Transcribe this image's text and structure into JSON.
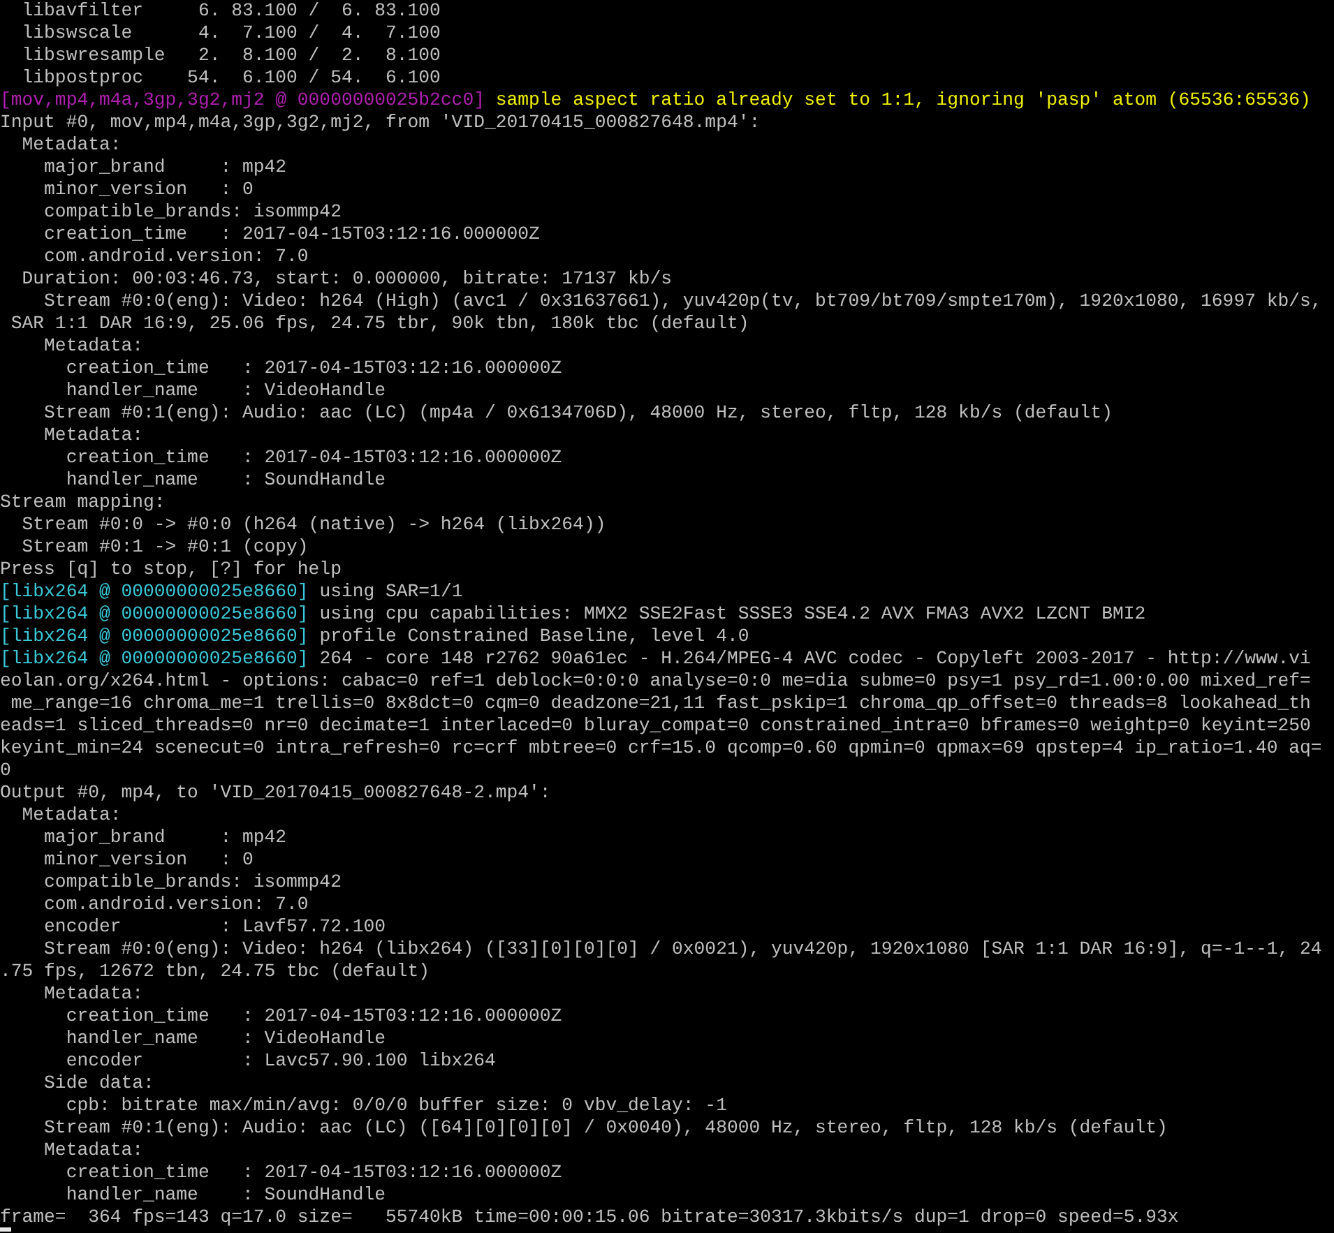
{
  "console": {
    "lines": [
      [
        {
          "kind": "plain",
          "text": "  libavfilter     6. 83.100 /  6. 83.100"
        }
      ],
      [
        {
          "kind": "plain",
          "text": "  libswscale      4.  7.100 /  4.  7.100"
        }
      ],
      [
        {
          "kind": "plain",
          "text": "  libswresample   2.  8.100 /  2.  8.100"
        }
      ],
      [
        {
          "kind": "plain",
          "text": "  libpostproc    54.  6.100 / 54.  6.100"
        }
      ],
      [
        {
          "kind": "demuxer",
          "text": "[mov,mp4,m4a,3gp,3g2,mj2 @ 00000000025b2cc0]"
        },
        {
          "kind": "warning",
          "text": " sample aspect ratio already set to 1:1, ignoring 'pasp' atom (65536:65536)"
        }
      ],
      [
        {
          "kind": "plain",
          "text": "Input #0, mov,mp4,m4a,3gp,3g2,mj2, from 'VID_20170415_000827648.mp4':"
        }
      ],
      [
        {
          "kind": "plain",
          "text": "  Metadata:"
        }
      ],
      [
        {
          "kind": "plain",
          "text": "    major_brand     : mp42"
        }
      ],
      [
        {
          "kind": "plain",
          "text": "    minor_version   : 0"
        }
      ],
      [
        {
          "kind": "plain",
          "text": "    compatible_brands: isommp42"
        }
      ],
      [
        {
          "kind": "plain",
          "text": "    creation_time   : 2017-04-15T03:12:16.000000Z"
        }
      ],
      [
        {
          "kind": "plain",
          "text": "    com.android.version: 7.0"
        }
      ],
      [
        {
          "kind": "plain",
          "text": "  Duration: 00:03:46.73, start: 0.000000, bitrate: 17137 kb/s"
        }
      ],
      [
        {
          "kind": "plain",
          "text": "    Stream #0:0(eng): Video: h264 (High) (avc1 / 0x31637661), yuv420p(tv, bt709/bt709/smpte170m), 1920x1080, 16997 kb/s,"
        }
      ],
      [
        {
          "kind": "plain",
          "text": " SAR 1:1 DAR 16:9, 25.06 fps, 24.75 tbr, 90k tbn, 180k tbc (default)"
        }
      ],
      [
        {
          "kind": "plain",
          "text": "    Metadata:"
        }
      ],
      [
        {
          "kind": "plain",
          "text": "      creation_time   : 2017-04-15T03:12:16.000000Z"
        }
      ],
      [
        {
          "kind": "plain",
          "text": "      handler_name    : VideoHandle"
        }
      ],
      [
        {
          "kind": "plain",
          "text": "    Stream #0:1(eng): Audio: aac (LC) (mp4a / 0x6134706D), 48000 Hz, stereo, fltp, 128 kb/s (default)"
        }
      ],
      [
        {
          "kind": "plain",
          "text": "    Metadata:"
        }
      ],
      [
        {
          "kind": "plain",
          "text": "      creation_time   : 2017-04-15T03:12:16.000000Z"
        }
      ],
      [
        {
          "kind": "plain",
          "text": "      handler_name    : SoundHandle"
        }
      ],
      [
        {
          "kind": "plain",
          "text": "Stream mapping:"
        }
      ],
      [
        {
          "kind": "plain",
          "text": "  Stream #0:0 -> #0:0 (h264 (native) -> h264 (libx264))"
        }
      ],
      [
        {
          "kind": "plain",
          "text": "  Stream #0:1 -> #0:1 (copy)"
        }
      ],
      [
        {
          "kind": "plain",
          "text": "Press [q] to stop, [?] for help"
        }
      ],
      [
        {
          "kind": "encoder",
          "text": "[libx264 @ 00000000025e8660]"
        },
        {
          "kind": "plain",
          "text": " using SAR=1/1"
        }
      ],
      [
        {
          "kind": "encoder",
          "text": "[libx264 @ 00000000025e8660]"
        },
        {
          "kind": "plain",
          "text": " using cpu capabilities: MMX2 SSE2Fast SSSE3 SSE4.2 AVX FMA3 AVX2 LZCNT BMI2"
        }
      ],
      [
        {
          "kind": "encoder",
          "text": "[libx264 @ 00000000025e8660]"
        },
        {
          "kind": "plain",
          "text": " profile Constrained Baseline, level 4.0"
        }
      ],
      [
        {
          "kind": "encoder",
          "text": "[libx264 @ 00000000025e8660]"
        },
        {
          "kind": "plain",
          "text": " 264 - core 148 r2762 90a61ec - H.264/MPEG-4 AVC codec - Copyleft 2003-2017 - http://www.vi"
        }
      ],
      [
        {
          "kind": "plain",
          "text": "eolan.org/x264.html - options: cabac=0 ref=1 deblock=0:0:0 analyse=0:0 me=dia subme=0 psy=1 psy_rd=1.00:0.00 mixed_ref="
        }
      ],
      [
        {
          "kind": "plain",
          "text": " me_range=16 chroma_me=1 trellis=0 8x8dct=0 cqm=0 deadzone=21,11 fast_pskip=1 chroma_qp_offset=0 threads=8 lookahead_th"
        }
      ],
      [
        {
          "kind": "plain",
          "text": "eads=1 sliced_threads=0 nr=0 decimate=1 interlaced=0 bluray_compat=0 constrained_intra=0 bframes=0 weightp=0 keyint=250"
        }
      ],
      [
        {
          "kind": "plain",
          "text": "keyint_min=24 scenecut=0 intra_refresh=0 rc=crf mbtree=0 crf=15.0 qcomp=0.60 qpmin=0 qpmax=69 qpstep=4 ip_ratio=1.40 aq="
        }
      ],
      [
        {
          "kind": "plain",
          "text": "0"
        }
      ],
      [
        {
          "kind": "plain",
          "text": "Output #0, mp4, to 'VID_20170415_000827648-2.mp4':"
        }
      ],
      [
        {
          "kind": "plain",
          "text": "  Metadata:"
        }
      ],
      [
        {
          "kind": "plain",
          "text": "    major_brand     : mp42"
        }
      ],
      [
        {
          "kind": "plain",
          "text": "    minor_version   : 0"
        }
      ],
      [
        {
          "kind": "plain",
          "text": "    compatible_brands: isommp42"
        }
      ],
      [
        {
          "kind": "plain",
          "text": "    com.android.version: 7.0"
        }
      ],
      [
        {
          "kind": "plain",
          "text": "    encoder         : Lavf57.72.100"
        }
      ],
      [
        {
          "kind": "plain",
          "text": "    Stream #0:0(eng): Video: h264 (libx264) ([33][0][0][0] / 0x0021), yuv420p, 1920x1080 [SAR 1:1 DAR 16:9], q=-1--1, 24"
        }
      ],
      [
        {
          "kind": "plain",
          "text": ".75 fps, 12672 tbn, 24.75 tbc (default)"
        }
      ],
      [
        {
          "kind": "plain",
          "text": "    Metadata:"
        }
      ],
      [
        {
          "kind": "plain",
          "text": "      creation_time   : 2017-04-15T03:12:16.000000Z"
        }
      ],
      [
        {
          "kind": "plain",
          "text": "      handler_name    : VideoHandle"
        }
      ],
      [
        {
          "kind": "plain",
          "text": "      encoder         : Lavc57.90.100 libx264"
        }
      ],
      [
        {
          "kind": "plain",
          "text": "    Side data:"
        }
      ],
      [
        {
          "kind": "plain",
          "text": "      cpb: bitrate max/min/avg: 0/0/0 buffer size: 0 vbv_delay: -1"
        }
      ],
      [
        {
          "kind": "plain",
          "text": "    Stream #0:1(eng): Audio: aac (LC) ([64][0][0][0] / 0x0040), 48000 Hz, stereo, fltp, 128 kb/s (default)"
        }
      ],
      [
        {
          "kind": "plain",
          "text": "    Metadata:"
        }
      ],
      [
        {
          "kind": "plain",
          "text": "      creation_time   : 2017-04-15T03:12:16.000000Z"
        }
      ],
      [
        {
          "kind": "plain",
          "text": "      handler_name    : SoundHandle"
        }
      ],
      [
        {
          "kind": "plain",
          "text": "frame=  364 fps=143 q=17.0 size=   55740kB time=00:00:15.06 bitrate=30317.3kbits/s dup=1 drop=0 speed=5.93x"
        }
      ]
    ],
    "cursor": {
      "visible": true
    }
  }
}
